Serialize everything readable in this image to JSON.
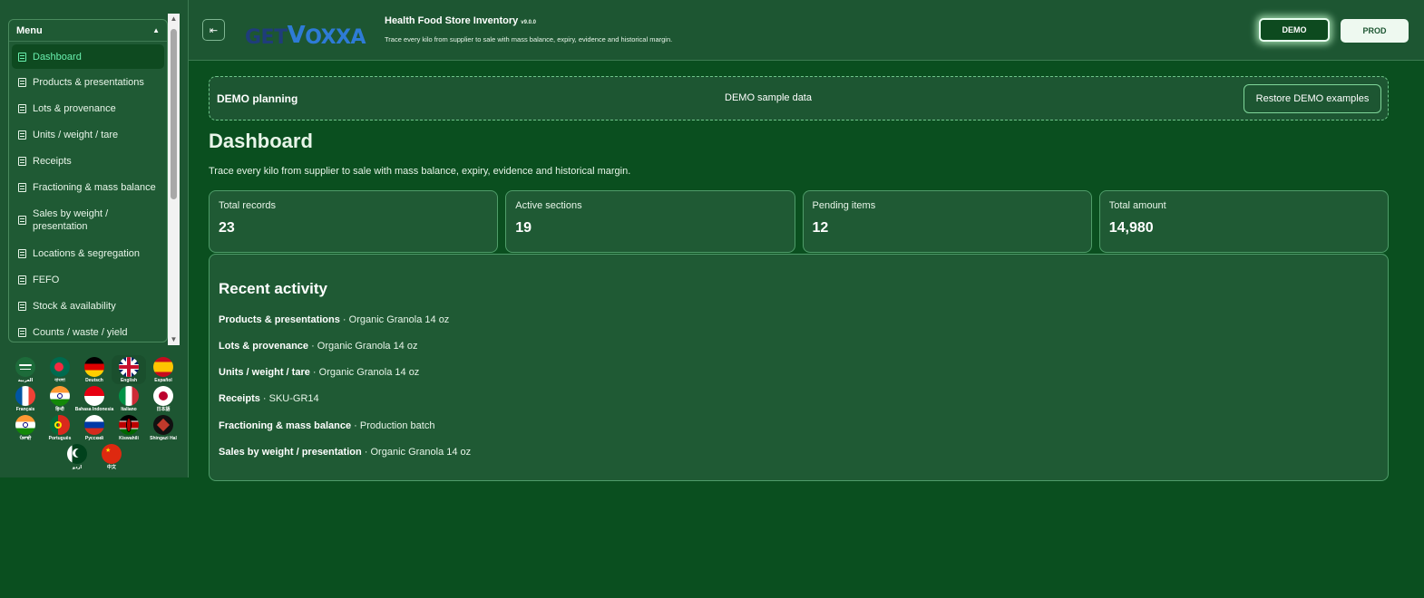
{
  "sidebar": {
    "menu_title": "Menu",
    "items": [
      {
        "label": "Dashboard",
        "active": true
      },
      {
        "label": "Products & presentations"
      },
      {
        "label": "Lots & provenance"
      },
      {
        "label": "Units / weight / tare"
      },
      {
        "label": "Receipts"
      },
      {
        "label": "Fractioning & mass balance"
      },
      {
        "label": "Sales by weight / presentation"
      },
      {
        "label": "Locations & segregation"
      },
      {
        "label": "FEFO"
      },
      {
        "label": "Stock & availability"
      },
      {
        "label": "Counts / waste / yield"
      }
    ],
    "languages": [
      {
        "name": "العربية",
        "icon": "saudi-flag-icon"
      },
      {
        "name": "বাংলা",
        "icon": "bangladesh-flag-icon"
      },
      {
        "name": "Deutsch",
        "icon": "germany-flag-icon"
      },
      {
        "name": "English",
        "icon": "uk-flag-icon",
        "selected": true
      },
      {
        "name": "Español",
        "icon": "spain-flag-icon"
      },
      {
        "name": "Français",
        "icon": "france-flag-icon"
      },
      {
        "name": "हिन्दी",
        "icon": "india-flag-icon"
      },
      {
        "name": "Bahasa Indonesia",
        "icon": "indonesia-flag-icon"
      },
      {
        "name": "Italiano",
        "icon": "italy-flag-icon"
      },
      {
        "name": "日本語",
        "icon": "japan-flag-icon"
      },
      {
        "name": "ਪੰਜਾਬੀ",
        "icon": "india-flag-icon"
      },
      {
        "name": "Português",
        "icon": "portugal-flag-icon"
      },
      {
        "name": "Русский",
        "icon": "russia-flag-icon"
      },
      {
        "name": "Kiswahili",
        "icon": "kenya-flag-icon"
      },
      {
        "name": "Shingazi Hal",
        "icon": "dark-emblem-flag-icon"
      },
      {
        "name": "اردو",
        "icon": "pakistan-flag-icon"
      },
      {
        "name": "中文",
        "icon": "china-flag-icon"
      }
    ]
  },
  "header": {
    "logo_text": {
      "get": "GET",
      "v": "V",
      "oxxa": "OXXA"
    },
    "title": "Health Food Store Inventory",
    "version": "v9.0.0",
    "subtitle": "Trace every kilo from supplier to sale with mass balance, expiry, evidence and historical margin.",
    "env_demo": "DEMO",
    "env_prod": "PROD",
    "collapse_icon": "collapse-sidebar-icon"
  },
  "banner": {
    "title": "DEMO planning",
    "middle": "DEMO sample data",
    "restore": "Restore DEMO examples"
  },
  "main": {
    "title": "Dashboard",
    "subtitle": "Trace every kilo from supplier to sale with mass balance, expiry, evidence and historical margin.",
    "stats": [
      {
        "label": "Total records",
        "value": "23"
      },
      {
        "label": "Active sections",
        "value": "19"
      },
      {
        "label": "Pending items",
        "value": "12"
      },
      {
        "label": "Total amount",
        "value": "14,980"
      }
    ],
    "activity_title": "Recent activity",
    "activity": [
      {
        "section": "Products & presentations",
        "detail": " · Organic Granola 14 oz"
      },
      {
        "section": "Lots & provenance",
        "detail": " · Organic Granola 14 oz"
      },
      {
        "section": "Units / weight / tare",
        "detail": " · Organic Granola 14 oz"
      },
      {
        "section": "Receipts",
        "detail": " · SKU-GR14"
      },
      {
        "section": "Fractioning & mass balance",
        "detail": " · Production batch"
      },
      {
        "section": "Sales by weight / presentation",
        "detail": " · Organic Granola 14 oz"
      }
    ]
  }
}
